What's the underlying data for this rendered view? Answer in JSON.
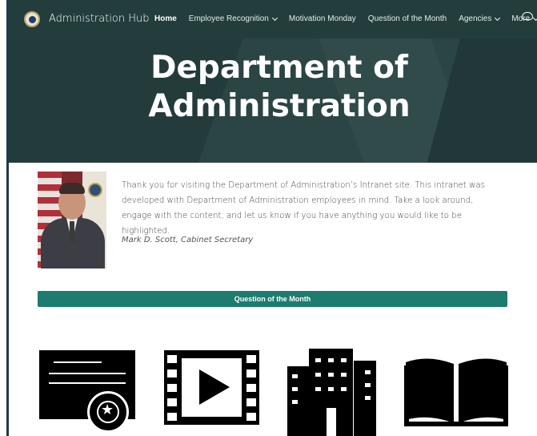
{
  "header": {
    "brand": "Administration Hub",
    "nav": [
      {
        "label": "Home",
        "active": true,
        "dropdown": false
      },
      {
        "label": "Employee Recognition",
        "active": false,
        "dropdown": true
      },
      {
        "label": "Motivation Monday",
        "active": false,
        "dropdown": false
      },
      {
        "label": "Question of the Month",
        "active": false,
        "dropdown": false
      },
      {
        "label": "Agencies",
        "active": false,
        "dropdown": true
      },
      {
        "label": "More",
        "active": false,
        "dropdown": true
      }
    ]
  },
  "hero": {
    "title_line1": "Department of",
    "title_line2": "Administration"
  },
  "intro": {
    "text": "Thank you for visiting the Department of Administration’s Intranet site. This intranet was developed with Department of Administration employees in mind. Take a look around, engage with the content, and let us know if you have anything you would like to be highlighted.",
    "signature": "Mark D. Scott, Cabinet Secretary"
  },
  "buttons": {
    "question_of_the_month": "Question of the Month"
  },
  "tiles": [
    {
      "icon": "certificate-icon"
    },
    {
      "icon": "video-icon"
    },
    {
      "icon": "building-icon"
    },
    {
      "icon": "book-icon"
    }
  ],
  "colors": {
    "topbar": "#233d3d",
    "hero": "#2b4444",
    "accent": "#1d7b6f"
  }
}
